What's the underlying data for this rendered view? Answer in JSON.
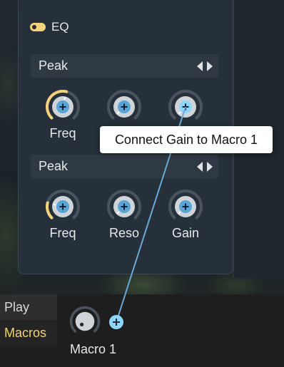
{
  "eq": {
    "title": "EQ",
    "enabled": true
  },
  "bands": [
    {
      "type_label": "Peak",
      "knobs": [
        {
          "label": "Freq",
          "value": 0.55,
          "arc_color": "#f2d27a"
        },
        {
          "label": "",
          "value": 0.0,
          "arc_color": "#5c6670"
        },
        {
          "label": "",
          "value": 0.0,
          "arc_color": "#5c6670"
        }
      ]
    },
    {
      "type_label": "Peak",
      "knobs": [
        {
          "label": "Freq",
          "value": 0.22,
          "arc_color": "#f2d27a"
        },
        {
          "label": "Reso",
          "value": 0.0,
          "arc_color": "#5c6670"
        },
        {
          "label": "Gain",
          "value": 0.0,
          "arc_color": "#5c6670"
        }
      ]
    }
  ],
  "tooltip": {
    "text": "Connect Gain to Macro 1"
  },
  "tabs": [
    {
      "label": "Play",
      "active": false
    },
    {
      "label": "Macros",
      "active": true
    }
  ],
  "macro": {
    "label": "Macro 1"
  },
  "colors": {
    "accent": "#f2d27a",
    "link": "#6aa9d8",
    "link_active": "#8fd6ff"
  }
}
